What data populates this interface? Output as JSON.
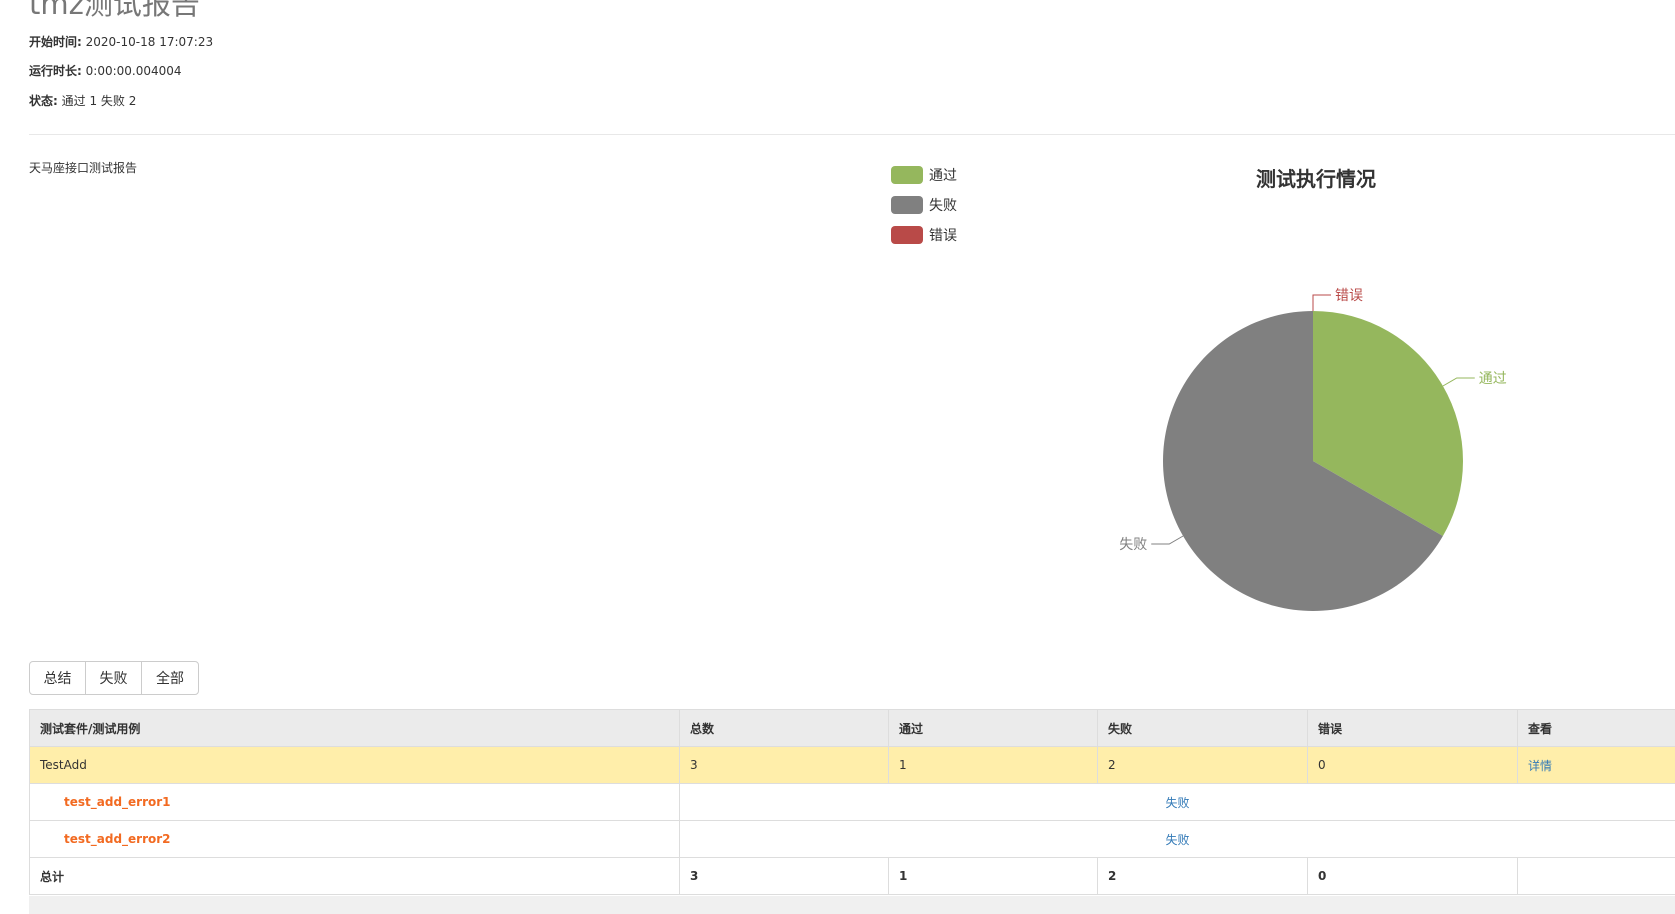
{
  "report": {
    "title": "tmz测试报告",
    "start_label": "开始时间:",
    "start_value": "2020-10-18 17:07:23",
    "duration_label": "运行时长:",
    "duration_value": "0:00:00.004004",
    "status_label": "状态:",
    "status_value": "通过 1 失败 2",
    "description": "天马座接口测试报告"
  },
  "chart_data": {
    "type": "pie",
    "title": "测试执行情况",
    "legend_position": "top-center",
    "categories": [
      "通过",
      "失败",
      "错误"
    ],
    "values": [
      1,
      2,
      0
    ],
    "colors": [
      "#95b75d",
      "#808080",
      "#b94a48"
    ]
  },
  "filters": {
    "summary": "总结",
    "failed": "失败",
    "all": "全部"
  },
  "table": {
    "headers": [
      "测试套件/测试用例",
      "总数",
      "通过",
      "失败",
      "错误",
      "查看"
    ],
    "suite": {
      "name": "TestAdd",
      "total": "3",
      "pass": "1",
      "fail": "2",
      "error": "0",
      "view": "详情"
    },
    "cases": [
      {
        "name": "test_add_error1",
        "status": "失败"
      },
      {
        "name": "test_add_error2",
        "status": "失败"
      }
    ],
    "totals": {
      "label": "总计",
      "total": "3",
      "pass": "1",
      "fail": "2",
      "error": "0"
    }
  }
}
